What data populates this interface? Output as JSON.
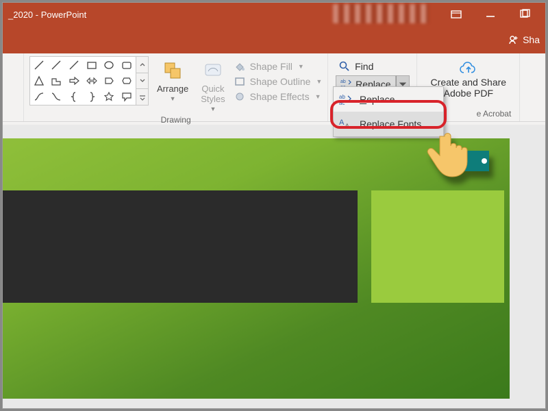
{
  "window": {
    "title_suffix": "_2020  -  PowerPoint"
  },
  "share": {
    "label": "Sha"
  },
  "ribbon": {
    "drawing": {
      "label": "Drawing",
      "arrange": "Arrange",
      "quick_styles": "Quick\nStyles",
      "shape_fill": "Shape Fill",
      "shape_outline": "Shape Outline",
      "shape_effects": "Shape Effects"
    },
    "editing": {
      "find": "Find",
      "replace": "Replace"
    },
    "adobe": {
      "line1": "Create and Share",
      "line2": "Adobe PDF",
      "group_label_right": "e Acrobat"
    }
  },
  "dropdown": {
    "replace": "Replace...",
    "replace_fonts": "Replace Fonts..."
  }
}
